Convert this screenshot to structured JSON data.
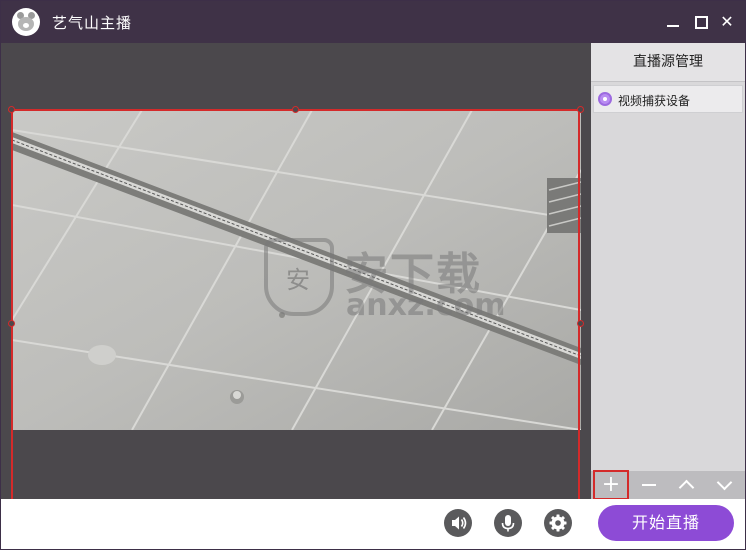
{
  "app": {
    "title": "艺气山主播"
  },
  "window_controls": {
    "minimize_icon": "minimize-icon",
    "maximize_icon": "maximize-icon",
    "close_glyph": "✕"
  },
  "source_panel": {
    "title": "直播源管理",
    "items": [
      {
        "label": "视频捕获设备",
        "selected": true
      }
    ],
    "toolbar": {
      "add": "+",
      "remove": "−",
      "up_icon": "chevron-up-icon",
      "down_icon": "chevron-down-icon"
    }
  },
  "watermark": {
    "shield_char": "安",
    "main": "安下载",
    "sub": "anxz.com"
  },
  "bottom": {
    "icons": [
      "speaker-icon",
      "microphone-icon",
      "gear-icon"
    ],
    "start_label": "开始直播"
  },
  "colors": {
    "titlebar": "#3f3247",
    "accent": "#8d4bd6",
    "selection": "#d42a2a",
    "preview_bg": "#4b484c"
  }
}
